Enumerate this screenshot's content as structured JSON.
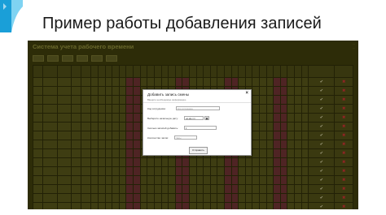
{
  "slide": {
    "title": "Пример работы добавления записей"
  },
  "app": {
    "title": "Система учета рабочего времени",
    "header_right_line1": "…",
    "header_right_line2": "…",
    "toolbar": [
      "",
      "",
      "",
      "",
      "",
      ""
    ],
    "rows": 16,
    "day_columns": 31,
    "red_columns": [
      5,
      6,
      12,
      13,
      19,
      20,
      26,
      27
    ]
  },
  "dialog": {
    "title": "Добавить запись смены",
    "subtitle": "Введите необходимую информацию",
    "close": "×",
    "fields": [
      {
        "label": "Код сотрудника:",
        "placeholder": "Код сотрудника"
      },
      {
        "label": "Выберите начальную дату:",
        "value": "дд.мм.гггг"
      },
      {
        "label": "Сколько записей добавить:",
        "value": "1"
      },
      {
        "label": "Количество часов:",
        "value": "Часы"
      }
    ],
    "submit": "Отправить"
  },
  "colors": {
    "app_bg": "#3c3b0b",
    "accent": "#1a9fd8",
    "weekend": "#6a3030"
  }
}
